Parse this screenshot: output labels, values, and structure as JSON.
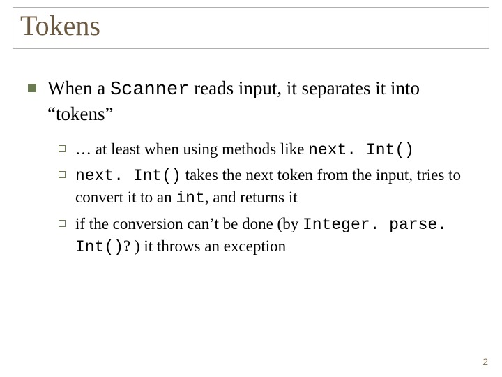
{
  "title": "Tokens",
  "main_point": {
    "pre": "When a ",
    "code": "Scanner",
    "post": " reads input, it separates it into “tokens”"
  },
  "sub_points": [
    {
      "pre": "… at least when using methods like ",
      "code1": "next. Int()",
      "post": ""
    },
    {
      "code1": "next. Int()",
      "mid": " takes the next token from the input, tries to convert it to an ",
      "code2": "int",
      "post": ", and returns it"
    },
    {
      "pre": "if the conversion can’t be done (by ",
      "code1": "Integer. parse. Int()",
      "post": "? ) it throws an exception"
    }
  ],
  "page_number": "2"
}
